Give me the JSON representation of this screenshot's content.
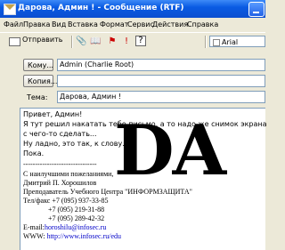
{
  "window": {
    "title": "Дарова, Админ ! - Сообщение (RTF)"
  },
  "menu": [
    "Файл",
    "Правка",
    "Вид",
    "Вставка",
    "Формат",
    "Сервис",
    "Действия",
    "Справка"
  ],
  "toolbar": {
    "send_label": "Отправить",
    "font_name": "Arial"
  },
  "header": {
    "to_label": "Кому...",
    "to_value": "Admin (Charlie Root)",
    "cc_label": "Копия...",
    "cc_value": "",
    "subject_label": "Тема:",
    "subject_value": "Дарова, Админ !"
  },
  "body": {
    "lines": [
      "Привет, Админ!",
      "   Я тут решил накатать тебе письмо, а то надо же снимок экрана",
      "с чего-то сделать...",
      "   Ну ладно, это так, к слову.",
      "  Пока."
    ],
    "separator": "-------------------------------",
    "signature": [
      "С наилучшими пожеланиями,",
      "Дмитрий П. Хорошилов",
      "Преподаватель Учебного Центра \"ИНФОРМЗАЩИТА\"",
      "Тел/факс +7 (095) 937-33-85",
      "              +7 (095) 219-31-88",
      "              +7 (095) 289-42-32"
    ],
    "email_label": "E-mail:",
    "email": "horoshilu@infosec.ru",
    "www_label": "WWW: ",
    "www": "http://www.infosec.ru/edu"
  },
  "overlay_text": "DA"
}
